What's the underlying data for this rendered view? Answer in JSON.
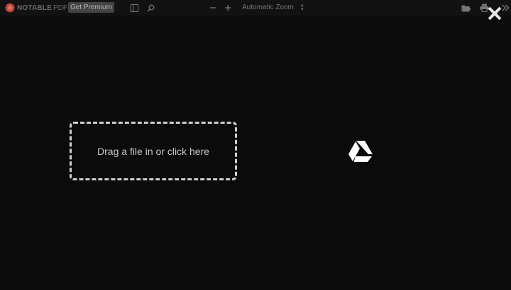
{
  "app": {
    "brand_name": "NOTABLE",
    "brand_suffix": "PDF"
  },
  "toolbar": {
    "premium_label": "Get Premium",
    "zoom_value": "Automatic Zoom",
    "icons": [
      "sidebar-toggle-icon",
      "search-icon",
      "zoom-out-icon",
      "zoom-in-icon",
      "open-folder-icon",
      "print-icon",
      "more-tools-icon"
    ]
  },
  "overlay": {
    "drop_label": "Drag a file in or click here",
    "close_icon": "close-icon",
    "drive_icon": "google-drive-icon"
  },
  "colors": {
    "background": "#0b0b0b",
    "toolbar": "#121212",
    "brand_accent": "#c0392b",
    "dashed_border": "#cfcfcf"
  }
}
